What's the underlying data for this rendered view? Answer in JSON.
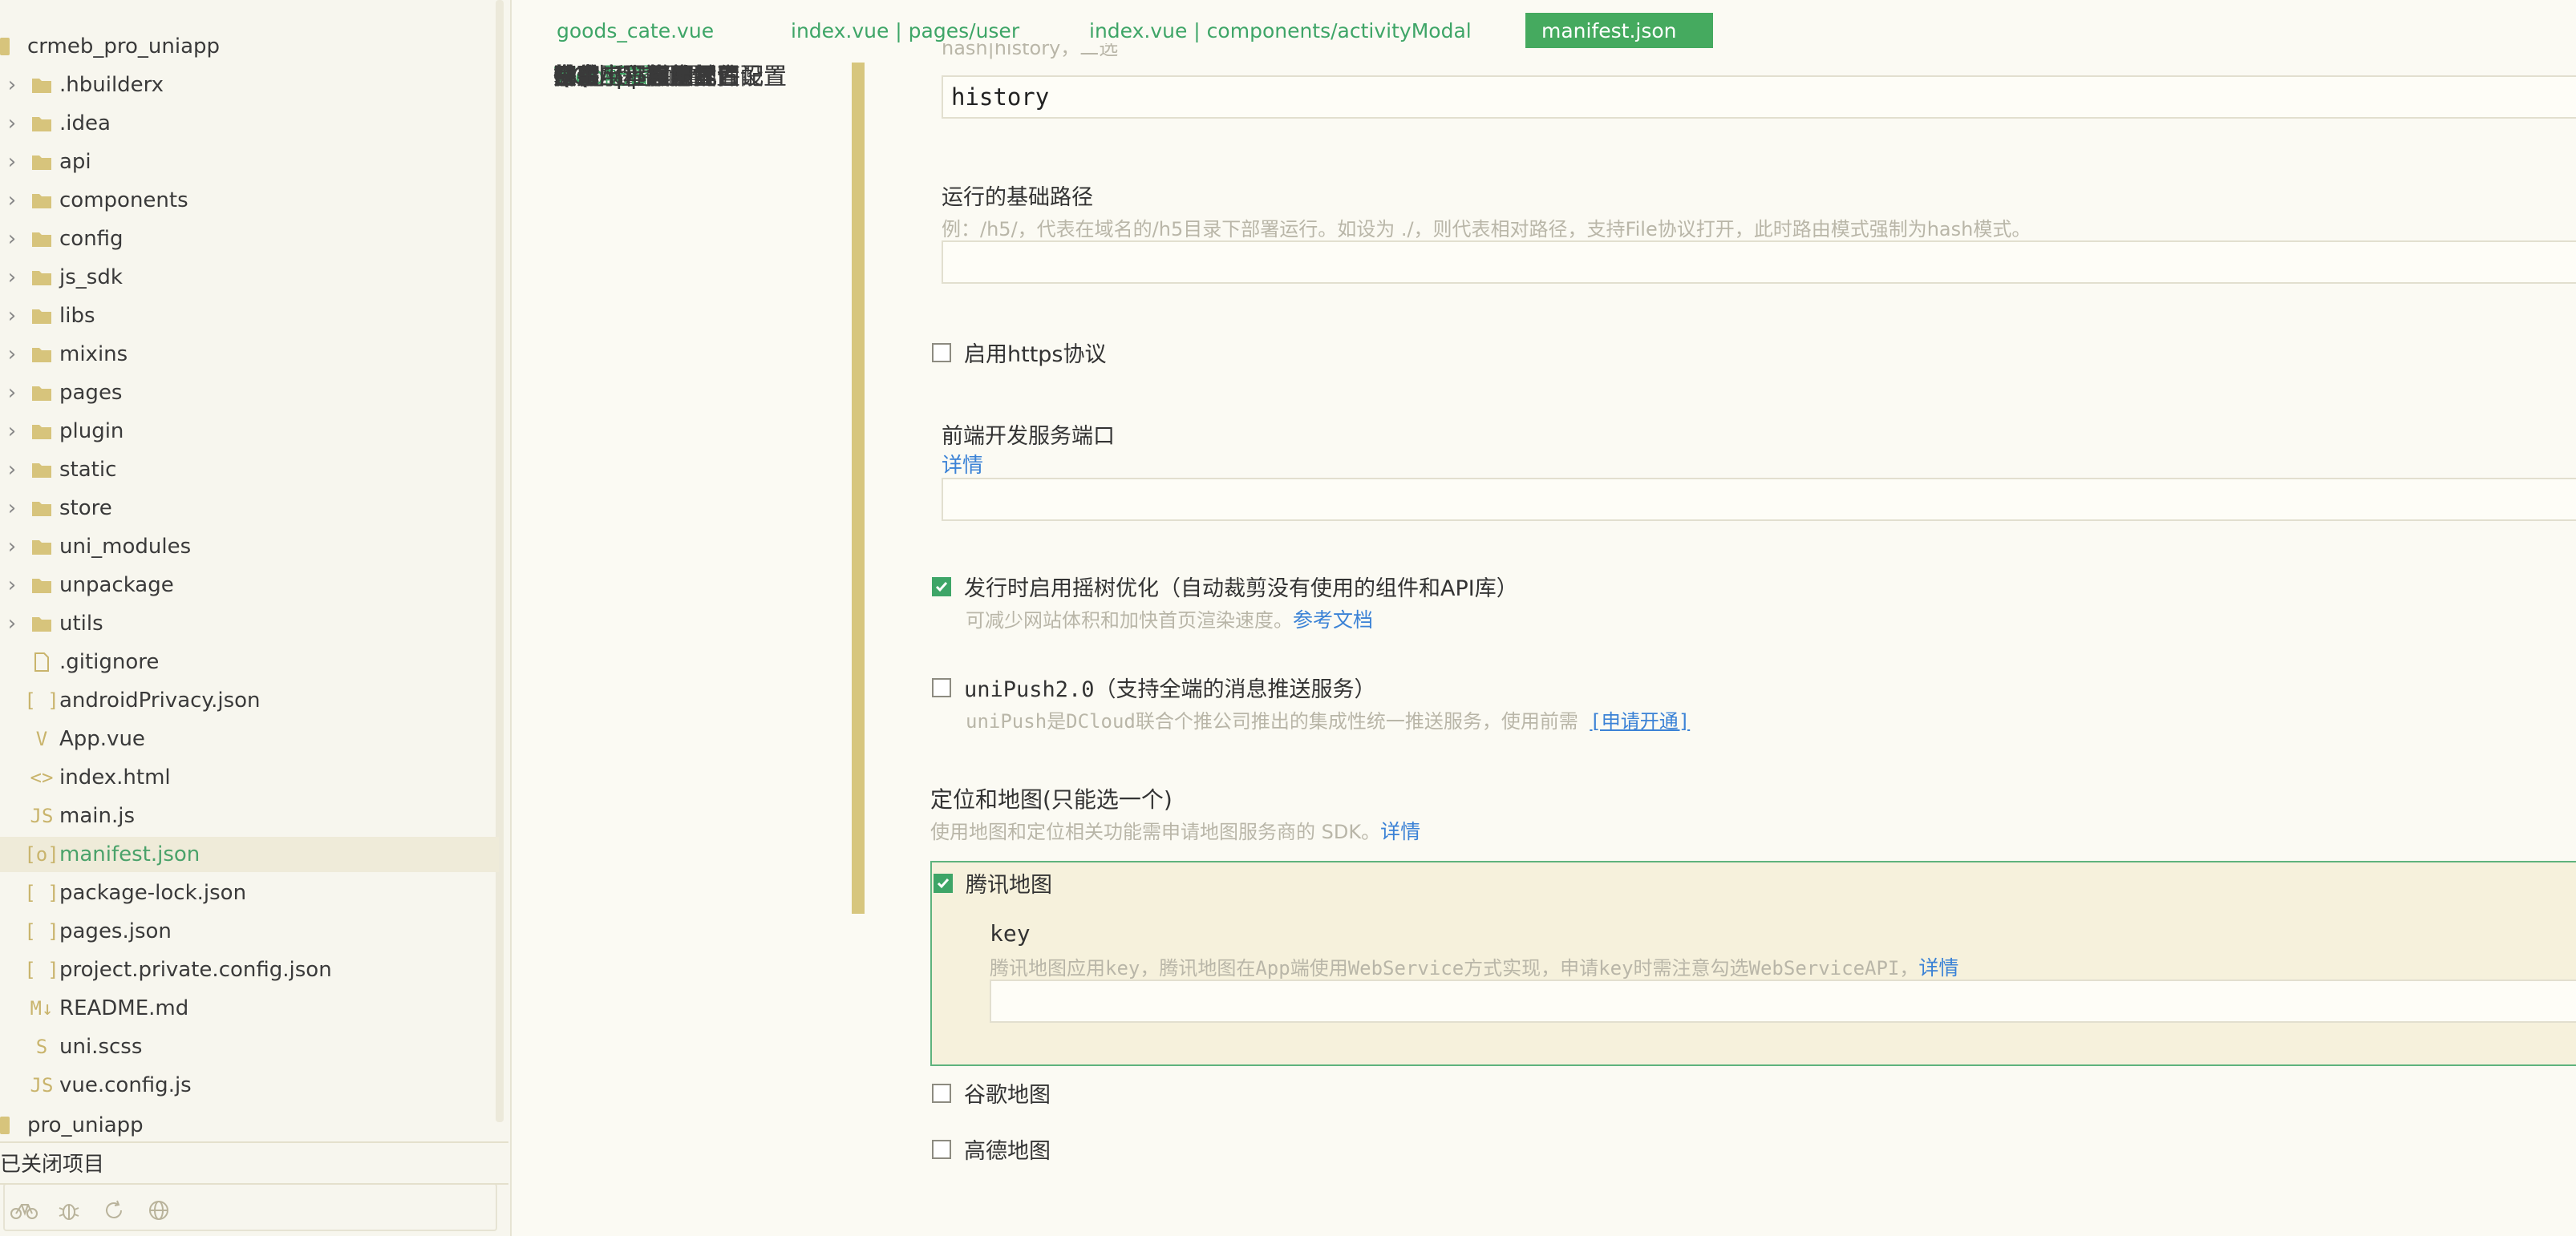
{
  "sidebar": {
    "project_name": "crmeb_pro_uniapp",
    "folders": [
      ".hbuilderx",
      ".idea",
      "api",
      "components",
      "config",
      "js_sdk",
      "libs",
      "mixins",
      "pages",
      "plugin",
      "static",
      "store",
      "uni_modules",
      "unpackage",
      "utils"
    ],
    "files": [
      {
        "name": ".gitignore",
        "icon": "file-icon",
        "glyph": ""
      },
      {
        "name": "androidPrivacy.json",
        "icon": "json-icon",
        "glyph": "[ ]"
      },
      {
        "name": "App.vue",
        "icon": "vue-icon",
        "glyph": "V"
      },
      {
        "name": "index.html",
        "icon": "html-icon",
        "glyph": "<>"
      },
      {
        "name": "main.js",
        "icon": "js-icon",
        "glyph": "JS"
      },
      {
        "name": "manifest.json",
        "icon": "manifest-icon",
        "glyph": "[o]"
      },
      {
        "name": "package-lock.json",
        "icon": "json-icon",
        "glyph": "[ ]"
      },
      {
        "name": "pages.json",
        "icon": "json-icon",
        "glyph": "[ ]"
      },
      {
        "name": "project.private.config.json",
        "icon": "json-icon",
        "glyph": "[ ]"
      },
      {
        "name": "README.md",
        "icon": "markdown-icon",
        "glyph": "M↓"
      },
      {
        "name": "uni.scss",
        "icon": "scss-icon",
        "glyph": "S"
      },
      {
        "name": "vue.config.js",
        "icon": "js-icon",
        "glyph": "JS"
      }
    ],
    "second_project": "pro_uniapp",
    "closed_projects": "已关闭项目"
  },
  "tabs": [
    {
      "label": "goods_cate.vue",
      "active": false
    },
    {
      "label": "index.vue | pages/user",
      "active": false
    },
    {
      "label": "index.vue | components/activityModal",
      "active": false
    },
    {
      "label": "manifest.json",
      "active": true
    }
  ],
  "config_nav": [
    "基础配置",
    "安卓/iOS图标配置",
    "安卓/iOS启动界面配置",
    "安卓/iOS模块配置",
    "安卓/iOS权限配置",
    "安卓/iOS原生插件配置",
    "安卓/iOS常用其它设置",
    "鸿蒙App配置",
    "Web配置",
    "微信小程序配置",
    "百度小程序配置",
    "抖音小程序配置",
    "支付宝小程序配置",
    "QQ小程序配置",
    "快手小程序配置",
    "飞书小程序配置",
    "京东小程序配置"
  ],
  "config_nav_active": "Web配置",
  "form": {
    "router_mode_hint_cut": "hash|history，二选",
    "router_mode_value": "history",
    "base_path_label": "运行的基础路径",
    "base_path_hint": "例：/h5/，代表在域名的/h5目录下部署运行。如设为 ./，则代表相对路径，支持File协议打开，此时路由模式强制为hash模式。",
    "base_path_value": "",
    "https_label": "启用https协议",
    "https_checked": false,
    "port_label": "前端开发服务端口",
    "port_link": "详情",
    "port_value": "",
    "treeshake_label": "发行时启用摇树优化（自动裁剪没有使用的组件和API库）",
    "treeshake_checked": true,
    "treeshake_hint": "可减少网站体积和加快首页渲染速度。",
    "treeshake_link": "参考文档",
    "unipush_label": "uniPush2.0（支持全端的消息推送服务）",
    "unipush_checked": false,
    "unipush_hint": "uniPush是DCloud联合个推公司推出的集成性统一推送服务，使用前需",
    "unipush_link": "[申请开通]",
    "map_section_title": "定位和地图(只能选一个)",
    "map_section_hint": "使用地图和定位相关功能需申请地图服务商的 SDK。",
    "map_section_link": "详情",
    "tencent_map_label": "腾讯地图",
    "tencent_map_checked": true,
    "key_label": "key",
    "key_hint": "腾讯地图应用key，腾讯地图在App端使用WebService方式实现，申请key时需注意勾选WebServiceAPI，",
    "key_link": "详情",
    "key_value": "",
    "google_map_label": "谷歌地图",
    "google_map_checked": false,
    "amap_label": "高德地图",
    "amap_checked": false
  },
  "colors": {
    "accent_green": "#45aa5f",
    "link_blue": "#3b82d6",
    "folder_tan": "#d7c47c",
    "background": "#fbfaf3"
  }
}
